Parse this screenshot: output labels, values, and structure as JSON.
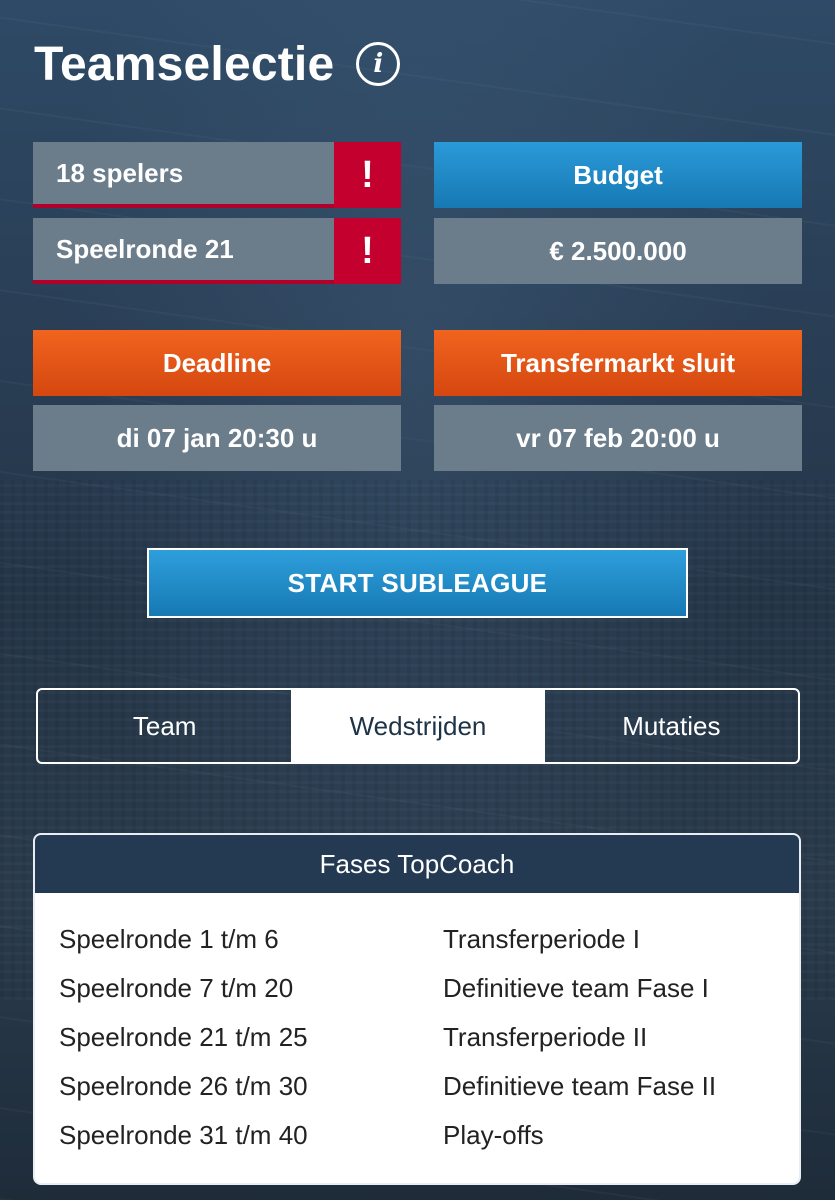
{
  "header": {
    "title": "Teamselectie",
    "info_icon": "info-icon"
  },
  "stats": {
    "players_label": "18 spelers",
    "round_label": "Speelronde 21",
    "alert_symbol": "!"
  },
  "budget": {
    "label": "Budget",
    "value": "€ 2.500.000"
  },
  "deadline": {
    "label": "Deadline",
    "value": "di 07 jan 20:30 u"
  },
  "transfer_market": {
    "label": "Transfermarkt sluit",
    "value": "vr 07 feb 20:00 u"
  },
  "start_button": "START SUBLEAGUE",
  "tabs": [
    {
      "label": "Team",
      "active": false
    },
    {
      "label": "Wedstrijden",
      "active": true
    },
    {
      "label": "Mutaties",
      "active": false
    }
  ],
  "phases": {
    "title": "Fases TopCoach",
    "rows": [
      {
        "round": "Speelronde 1 t/m 6",
        "desc": "Transferperiode I"
      },
      {
        "round": "Speelronde 7 t/m 20",
        "desc": "Definitieve team Fase I"
      },
      {
        "round": "Speelronde 21 t/m 25",
        "desc": "Transferperiode II"
      },
      {
        "round": "Speelronde 26 t/m 30",
        "desc": "Definitieve team Fase II"
      },
      {
        "round": "Speelronde 31 t/m 40",
        "desc": "Play-offs"
      }
    ]
  },
  "colors": {
    "accent_blue": "#1f8ccb",
    "accent_orange": "#e2541a",
    "alert_red": "#c4002f",
    "panel_grey": "#6b7c8b"
  }
}
